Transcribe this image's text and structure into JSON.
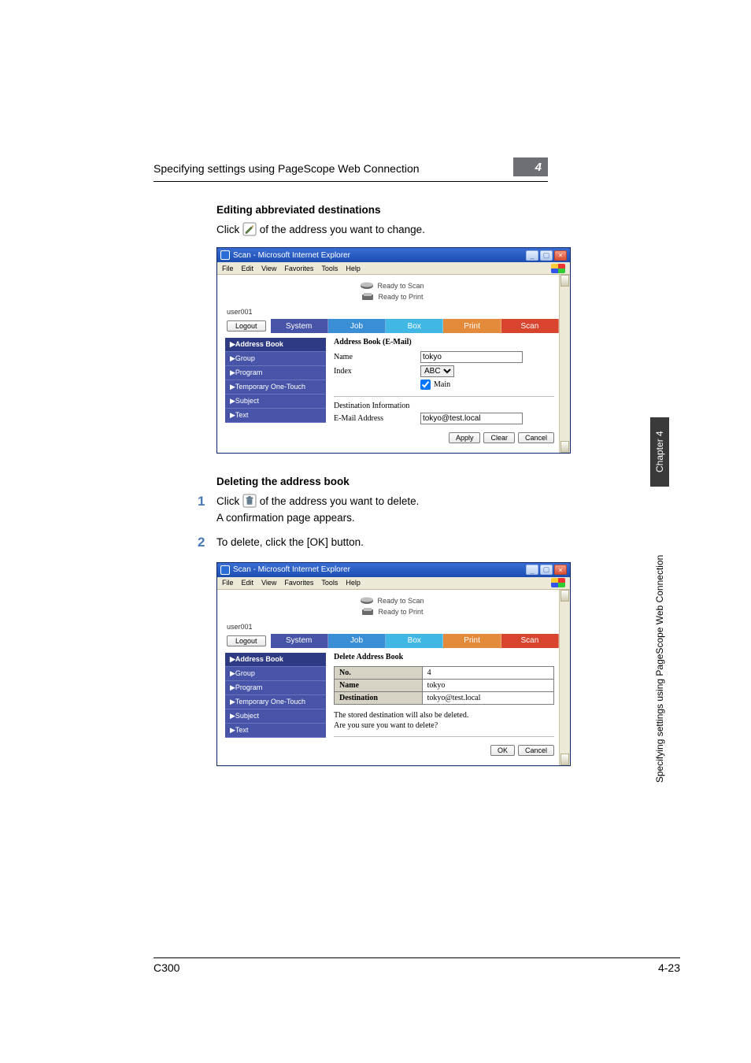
{
  "header": {
    "text": "Specifying settings using PageScope Web Connection",
    "chapter_num": "4"
  },
  "h1": "Editing abbreviated destinations",
  "p1_a": "Click ",
  "p1_b": " of the address you want to change.",
  "h2": "Deleting the address book",
  "step1_num": "1",
  "step1_a": "Click ",
  "step1_b": " of the address you want to delete.",
  "step1_c": "A confirmation page appears.",
  "step2_num": "2",
  "step2": "To delete, click the [OK] button.",
  "browser": {
    "title": "Scan - Microsoft Internet Explorer",
    "menus": {
      "file": "File",
      "edit": "Edit",
      "view": "View",
      "fav": "Favorites",
      "tools": "Tools",
      "help": "Help"
    },
    "ready_scan": "Ready to Scan",
    "ready_print": "Ready to Print",
    "user": "user001",
    "logout": "Logout",
    "tabs": {
      "system": "System",
      "job": "Job",
      "box": "Box",
      "print": "Print",
      "scan": "Scan"
    },
    "nav": {
      "address": "▶Address Book",
      "group": "▶Group",
      "program": "▶Program",
      "temp": "▶Temporary One-Touch",
      "subject": "▶Subject",
      "text": "▶Text"
    }
  },
  "b1": {
    "heading": "Address Book (E-Mail)",
    "name_lab": "Name",
    "name_val": "tokyo",
    "index_lab": "Index",
    "index_val": "ABC",
    "main_lab": "Main",
    "main_checked": true,
    "dest_hd": "Destination Information",
    "email_lab": "E-Mail Address",
    "email_val": "tokyo@test.local",
    "apply": "Apply",
    "clear": "Clear",
    "cancel": "Cancel"
  },
  "b2": {
    "heading": "Delete Address Book",
    "no_lab": "No.",
    "no_val": "4",
    "name_lab": "Name",
    "name_val": "tokyo",
    "dest_lab": "Destination",
    "dest_val": "tokyo@test.local",
    "msg1": "The stored destination will also be deleted.",
    "msg2": "Are you sure you want to delete?",
    "ok": "OK",
    "cancel": "Cancel"
  },
  "side": {
    "chapter": "Chapter 4",
    "long": "Specifying settings using PageScope Web Connection"
  },
  "footer": {
    "left": "C300",
    "right": "4-23"
  }
}
